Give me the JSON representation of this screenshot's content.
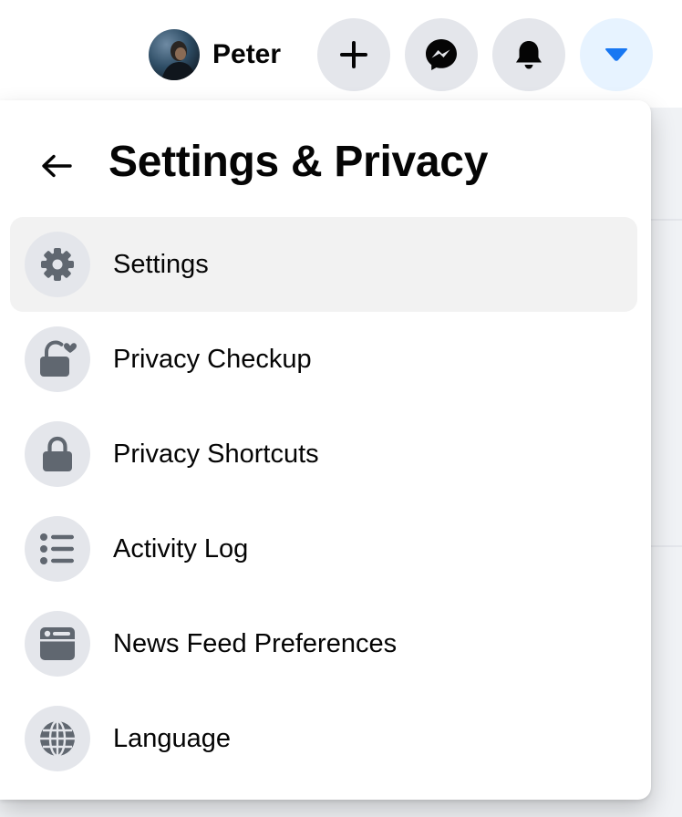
{
  "colors": {
    "accent": "#1877f2",
    "icon_grey": "#606770",
    "button_bg": "#e4e6eb",
    "hover_bg": "#f2f2f2",
    "active_button_bg": "#e7f3ff"
  },
  "header": {
    "profile_name": "Peter",
    "buttons": [
      {
        "icon": "plus-icon"
      },
      {
        "icon": "messenger-icon"
      },
      {
        "icon": "bell-icon"
      },
      {
        "icon": "caret-down-icon"
      }
    ]
  },
  "panel": {
    "title": "Settings & Privacy",
    "back_icon": "arrow-left-icon",
    "items": [
      {
        "label": "Settings",
        "icon": "gear-icon"
      },
      {
        "label": "Privacy Checkup",
        "icon": "lock-heart-icon"
      },
      {
        "label": "Privacy Shortcuts",
        "icon": "lock-icon"
      },
      {
        "label": "Activity Log",
        "icon": "list-icon"
      },
      {
        "label": "News Feed Preferences",
        "icon": "news-feed-icon"
      },
      {
        "label": "Language",
        "icon": "globe-icon"
      }
    ]
  }
}
